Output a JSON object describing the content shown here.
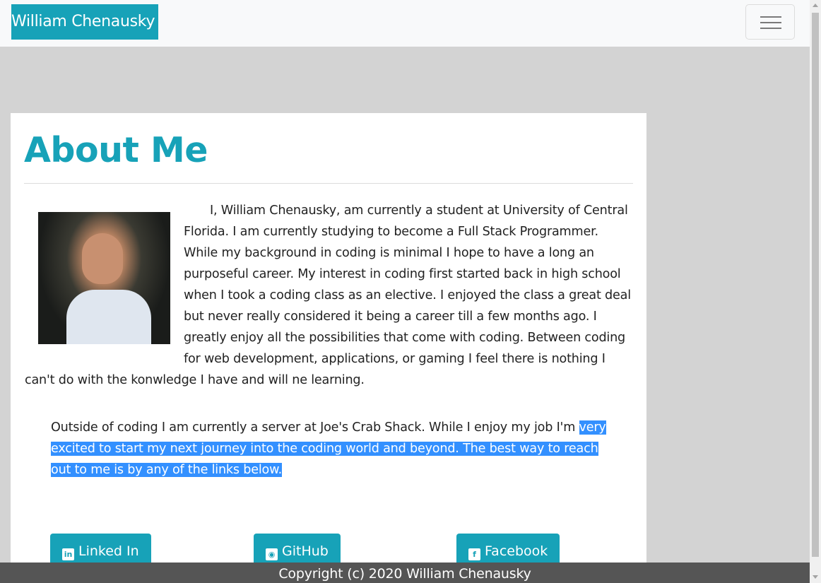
{
  "navbar": {
    "brand": "William Chenausky",
    "toggler_icon": "hamburger-menu-icon"
  },
  "about": {
    "title": "About Me",
    "photo_alt": "William Chenausky portrait",
    "paragraph1": "I, William Chenausky, am currently a student at University of Central Florida. I am currently studying to become a Full Stack Programmer. While my background in coding is minimal I hope to have a long an purposeful career. My interest in coding first started back in high school when I took a coding class as an elective. I enjoyed the class a great deal but never really considered it being a career till a few months ago. I greatly enjoy all the possibilities that come with coding. Between coding for web development, applications, or gaming I feel there is nothing I can't do with the konwledge I have and will ne learning.",
    "paragraph2_plain": "Outside of coding I am currently a server at Joe's Crab Shack. While I enjoy my job I'm ",
    "paragraph2_selected": "very excited to start my next journey into the coding world and beyond. The best way to reach out to me is by any of the links below."
  },
  "social": {
    "linkedin": {
      "label": "Linked In",
      "icon": "linkedin-icon",
      "glyph": "in"
    },
    "github": {
      "label": "GitHub",
      "icon": "github-icon",
      "glyph": "◉"
    },
    "facebook": {
      "label": "Facebook",
      "icon": "facebook-icon",
      "glyph": "f"
    }
  },
  "footer": {
    "copyright": "Copyright (c) 2020 William Chenausky"
  },
  "colors": {
    "accent": "#17a2b8",
    "page_bg": "#d3d3d3",
    "footer_bg": "#555555",
    "selection": "#3390ff"
  }
}
